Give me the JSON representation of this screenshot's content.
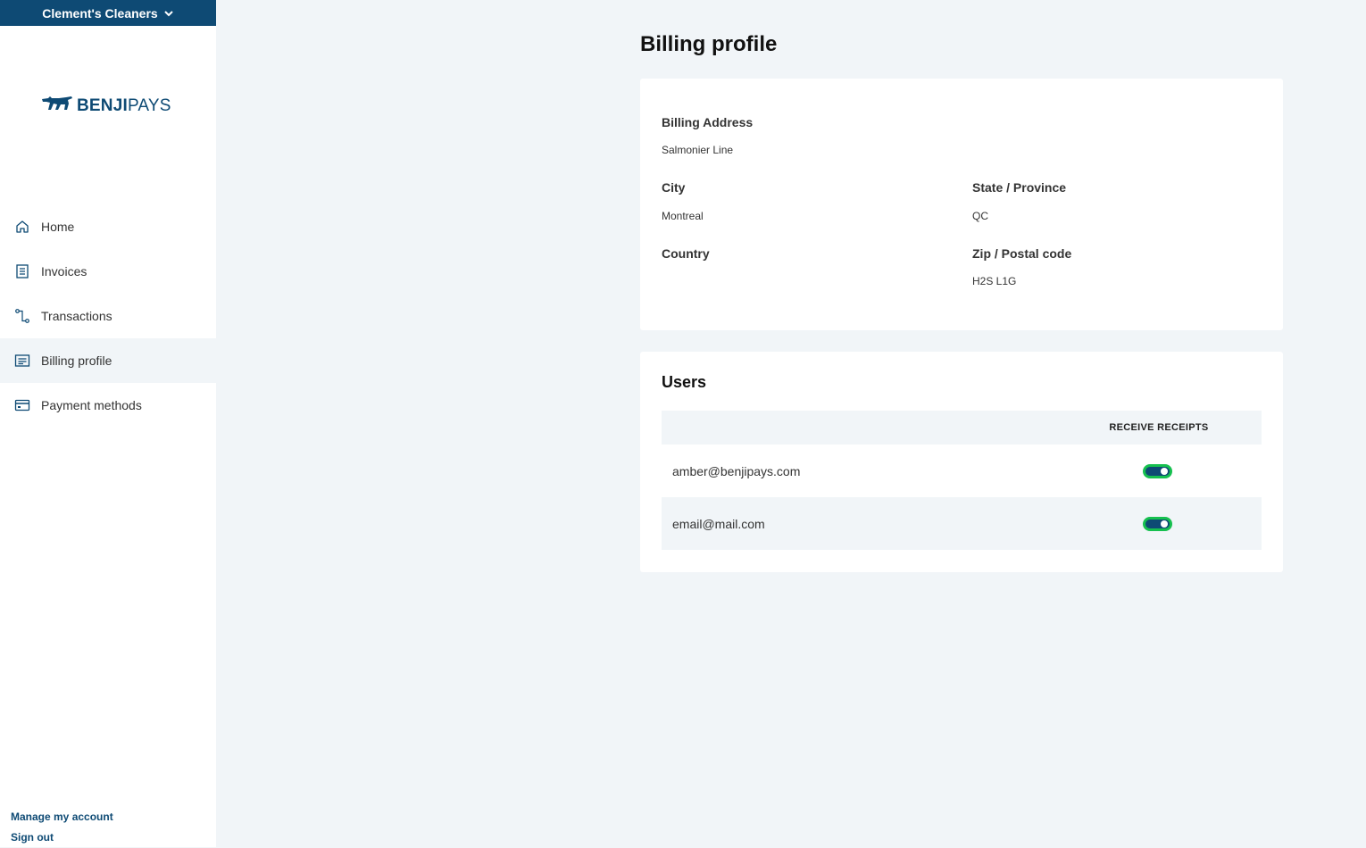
{
  "org": {
    "name": "Clement's Cleaners"
  },
  "logo": {
    "brand_bold": "BENJI",
    "brand_light": "PAYS"
  },
  "nav": {
    "items": [
      {
        "label": "Home",
        "icon": "home-icon"
      },
      {
        "label": "Invoices",
        "icon": "invoice-icon"
      },
      {
        "label": "Transactions",
        "icon": "transactions-icon"
      },
      {
        "label": "Billing profile",
        "icon": "billing-icon",
        "active": true
      },
      {
        "label": "Payment methods",
        "icon": "card-icon"
      }
    ]
  },
  "account": {
    "manage_label": "Manage my account",
    "signout_label": "Sign out"
  },
  "page": {
    "title": "Billing profile"
  },
  "billing": {
    "address_label": "Billing Address",
    "address_value": "Salmonier Line",
    "city_label": "City",
    "city_value": "Montreal",
    "state_label": "State / Province",
    "state_value": "QC",
    "country_label": "Country",
    "country_value": "",
    "zip_label": "Zip / Postal code",
    "zip_value": "H2S L1G"
  },
  "users": {
    "title": "Users",
    "col_receipts": "RECEIVE RECEIPTS",
    "rows": [
      {
        "email": "amber@benjipays.com",
        "receive_receipts": true
      },
      {
        "email": "email@mail.com",
        "receive_receipts": true
      }
    ]
  },
  "colors": {
    "brand": "#0e4a74",
    "toggle_on": "#16c04f",
    "background": "#f1f5f8"
  }
}
